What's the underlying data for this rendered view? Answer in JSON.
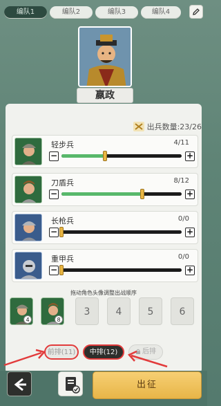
{
  "tabs": [
    "编队1",
    "编队2",
    "编队3",
    "编队4"
  ],
  "hero": {
    "name": "嬴政"
  },
  "troops": {
    "label": "出兵数量:23/26"
  },
  "units": [
    {
      "name": "轻步兵",
      "count": "4/11",
      "fill": 0.36,
      "style": "green"
    },
    {
      "name": "刀盾兵",
      "count": "8/12",
      "fill": 0.67,
      "style": "green"
    },
    {
      "name": "长枪兵",
      "count": "0/0",
      "fill": 0,
      "style": "blue"
    },
    {
      "name": "重甲兵",
      "count": "0/0",
      "fill": 0,
      "style": "blue"
    }
  ],
  "order": {
    "hint": "拖动角色头像调整出战顺序",
    "slots": [
      {
        "badge": "4"
      },
      {
        "badge": "8"
      },
      {
        "label": "3"
      },
      {
        "label": "4"
      },
      {
        "label": "5"
      },
      {
        "label": "6"
      }
    ]
  },
  "rows": {
    "front": "前排(11)",
    "mid": "中排(12)",
    "back": "后排"
  },
  "bottom": {
    "march": "出征"
  },
  "colors": {
    "accent": "#e23b3b",
    "march": "#f6cf73",
    "slider_fill": "#58b86b"
  }
}
